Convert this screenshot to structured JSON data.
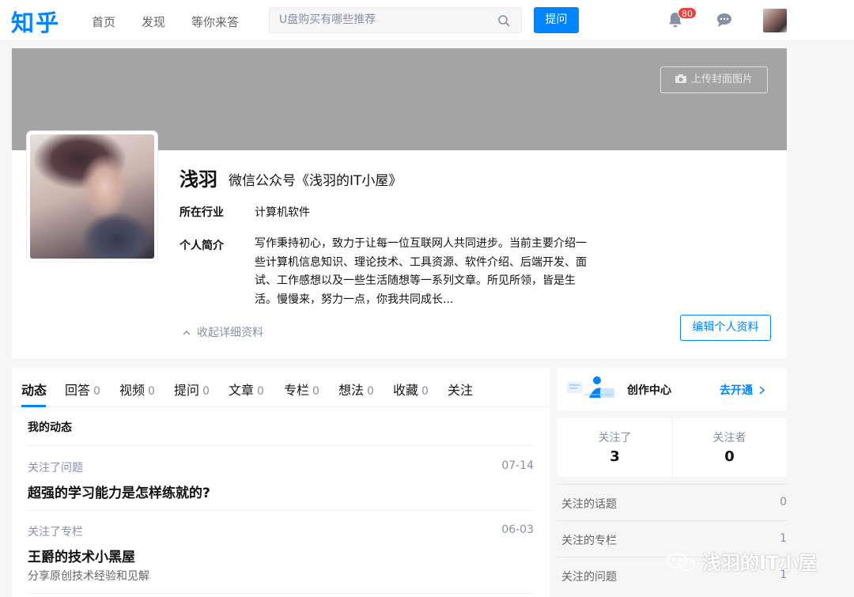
{
  "header": {
    "logo": "知乎",
    "nav": [
      "首页",
      "发现",
      "等你来答"
    ],
    "search_placeholder": "U盘购买有哪些推荐",
    "ask_label": "提问",
    "notification_count": "80"
  },
  "profile": {
    "upload_cover_label": "上传封面图片",
    "name": "浅羽",
    "headline": "微信公众号《浅羽的IT小屋》",
    "industry_label": "所在行业",
    "industry_value": "计算机软件",
    "bio_label": "个人简介",
    "bio_value": "写作秉持初心，致力于让每一位互联网人共同进步。当前主要介绍一些计算机信息知识、理论技术、工具资源、软件介绍、后端开发、面试、工作感想以及一些生活随想等一系列文章。所见所领，皆是生活。慢慢来，努力一点，你我共同成长...",
    "collapse_label": "收起详细资料",
    "edit_label": "编辑个人资料"
  },
  "tabs": [
    {
      "label": "动态",
      "count": ""
    },
    {
      "label": "回答",
      "count": "0"
    },
    {
      "label": "视频",
      "count": "0"
    },
    {
      "label": "提问",
      "count": "0"
    },
    {
      "label": "文章",
      "count": "0"
    },
    {
      "label": "专栏",
      "count": "0"
    },
    {
      "label": "想法",
      "count": "0"
    },
    {
      "label": "收藏",
      "count": "0"
    },
    {
      "label": "关注",
      "count": ""
    }
  ],
  "feed": {
    "section_title": "我的动态",
    "activities": [
      {
        "meta": "关注了问题",
        "date": "07-14",
        "title": "超强的学习能力是怎样练就的?",
        "desc": ""
      },
      {
        "meta": "关注了专栏",
        "date": "06-03",
        "title": "王爵的技术小黑屋",
        "desc": "分享原创技术经验和见解"
      }
    ]
  },
  "sidebar": {
    "creator_title": "创作中心",
    "creator_link": "去开通",
    "following_label": "关注了",
    "following_count": "3",
    "followers_label": "关注者",
    "followers_count": "0",
    "rows": [
      {
        "label": "关注的话题",
        "value": "0"
      },
      {
        "label": "关注的专栏",
        "value": "1"
      },
      {
        "label": "关注的问题",
        "value": "1"
      }
    ]
  },
  "watermark": "浅羽的IT小屋",
  "colors": {
    "brand": "#0084ff",
    "badge": "#f1403c",
    "cover": "#a4a4a4"
  }
}
